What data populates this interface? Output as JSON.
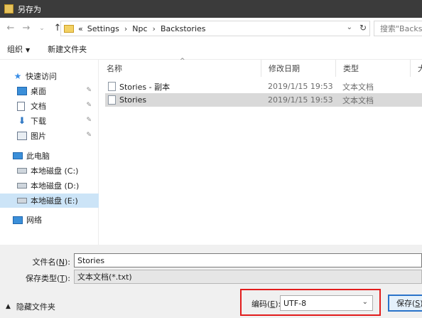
{
  "window": {
    "title": "另存为"
  },
  "address": {
    "overflow": "«",
    "crumbs": [
      "Settings",
      "Npc",
      "Backstories"
    ],
    "separator": "›",
    "search_placeholder": "搜索\"Backst"
  },
  "toolbar": {
    "organize": "组织",
    "new_folder": "新建文件夹"
  },
  "nav": {
    "quick_access": "快速访问",
    "desktop": "桌面",
    "documents": "文档",
    "downloads": "下载",
    "pictures": "图片",
    "this_pc": "此电脑",
    "drive_c": "本地磁盘 (C:)",
    "drive_d": "本地磁盘 (D:)",
    "drive_e": "本地磁盘 (E:)",
    "network": "网络"
  },
  "columns": {
    "name": "名称",
    "modified": "修改日期",
    "type": "类型",
    "size": "大"
  },
  "files": [
    {
      "name": "Stories - 副本",
      "modified": "2019/1/15 19:53",
      "type": "文本文档"
    },
    {
      "name": "Stories",
      "modified": "2019/1/15 19:53",
      "type": "文本文档"
    }
  ],
  "form": {
    "filename_label": "文件名",
    "filename_key": "N",
    "filename_value": "Stories",
    "filetype_label": "保存类型",
    "filetype_key": "T",
    "filetype_value": "文本文档(*.txt)"
  },
  "footer": {
    "hide_folders": "隐藏文件夹",
    "encoding_label": "编码",
    "encoding_key": "E",
    "encoding_value": "UTF-8",
    "save_label": "保存",
    "save_key": "S"
  },
  "colors": {
    "highlight": "#e21c1c",
    "selection": "#cce4f7",
    "accent": "#2a73c9"
  }
}
